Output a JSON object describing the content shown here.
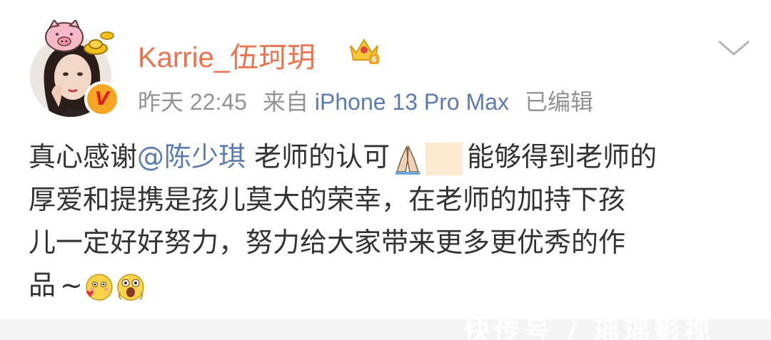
{
  "post": {
    "username": "Karrie_伍珂玥",
    "time": "昨天 22:45",
    "source_prefix": "来自",
    "device": "iPhone 13 Pro Max",
    "edited": "已编辑",
    "content": {
      "line1_pre": "真心感谢",
      "mention": "@陈少琪",
      "line1_mid": " 老师的认可",
      "line1_post": "能够得到老师的",
      "line2": "厚爱和提携是孩儿莫大的荣幸，在老师的加持下孩",
      "line3": "儿一定好好努力，努力给大家带来更多更优秀的作",
      "line4": "品",
      "line4_tilde": "~"
    }
  },
  "icons": {
    "avatar": "avatar-photo",
    "decoration": "pig-with-gold-ingot-icon",
    "badge": "verified-v-badge-icon",
    "membership": "crown-level-6-icon",
    "more": "chevron-down-icon",
    "emoji1": "folded-hands-emoji",
    "emoji2": "skin-tone-modifier",
    "emoji3": "blowing-kiss-emoji",
    "emoji4": "surprised-face-emoji"
  },
  "colors": {
    "username": "#eb7350",
    "mention": "#5b7bae",
    "meta": "#939393",
    "text": "#333333",
    "badge_bg": "#f6a623",
    "badge_fg": "#e02020"
  },
  "watermark": "快传号 / 瑶瑶影视"
}
